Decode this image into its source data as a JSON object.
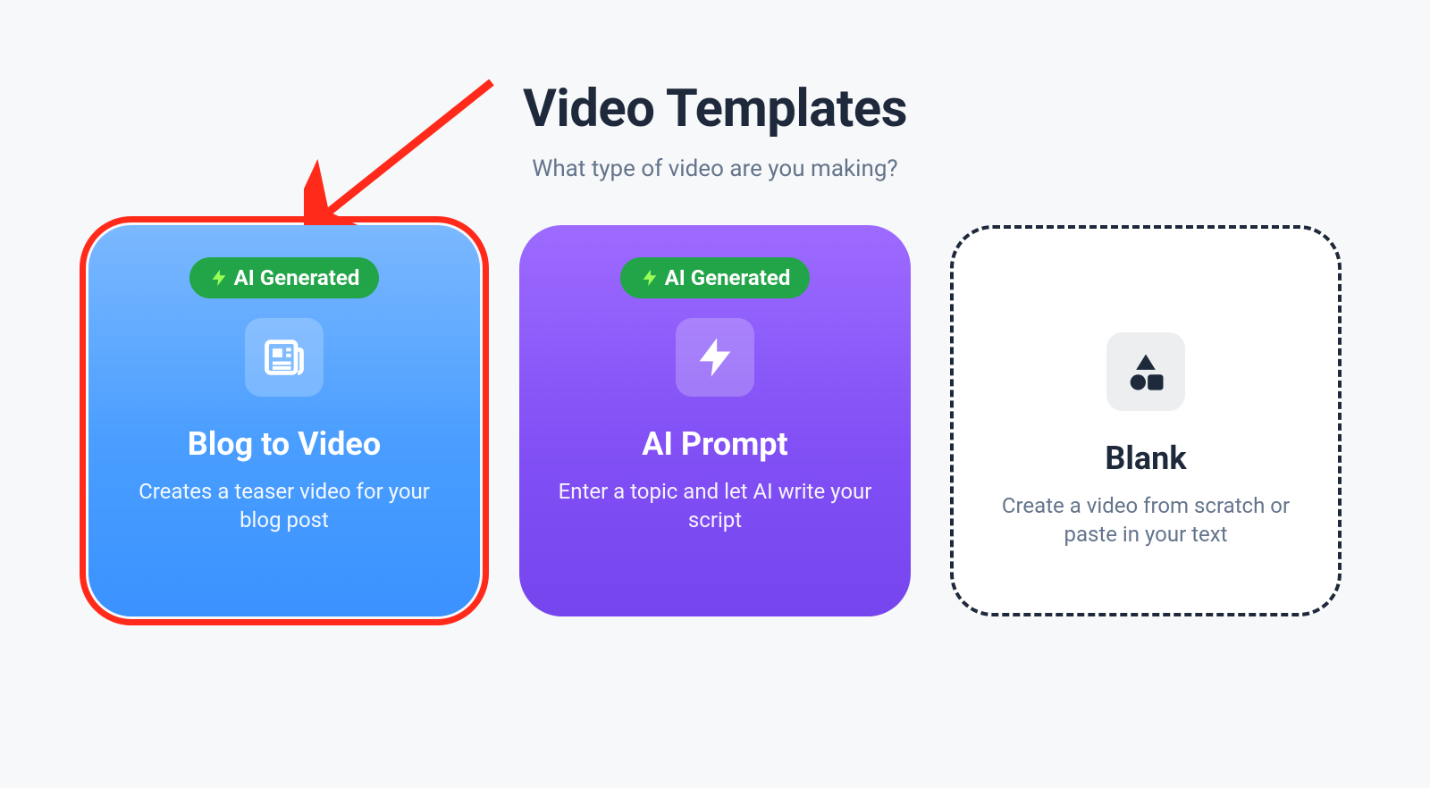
{
  "header": {
    "title": "Video Templates",
    "subtitle": "What type of video are you making?"
  },
  "badge_label": "AI Generated",
  "cards": [
    {
      "id": "blog-to-video",
      "badge": true,
      "title": "Blog to Video",
      "description": "Creates a teaser video for your blog post",
      "highlighted": true
    },
    {
      "id": "ai-prompt",
      "badge": true,
      "title": "AI Prompt",
      "description": "Enter a topic and let AI write your script",
      "highlighted": false
    },
    {
      "id": "blank",
      "badge": false,
      "title": "Blank",
      "description": "Create a video from scratch or paste in your text",
      "highlighted": false
    }
  ]
}
